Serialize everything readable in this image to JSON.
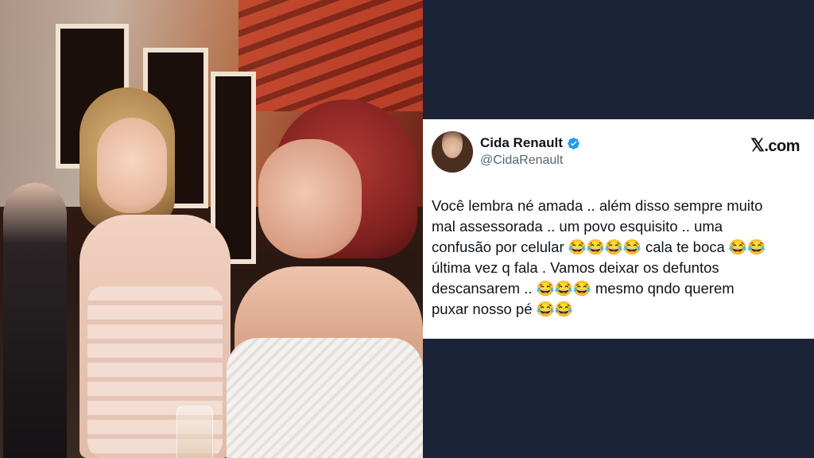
{
  "tweet": {
    "display_name": "Cida Renault",
    "handle": "@CidaRenault",
    "verified": true,
    "site_label": "X.com",
    "site_x": "𝕏",
    "site_suffix": ".com",
    "text": "Você lembra né amada .. além disso sempre muito\nmal assessorada .. um povo esquisito .. uma\nconfusão por celular 😂😂😂😂 cala te boca 😂😂\núltima vez q fala . Vamos deixar os defuntos\ndescansarem .. 😂😂😂 mesmo qndo querem\npuxar nosso pé 😂😂"
  },
  "colors": {
    "background": "#1a2338",
    "card": "#ffffff",
    "verified_badge": "#1d9bf0",
    "text_primary": "#0f1419",
    "text_secondary": "#536471"
  },
  "icons": {
    "verified": "verified-badge-icon",
    "x_logo": "x-logo-icon"
  }
}
